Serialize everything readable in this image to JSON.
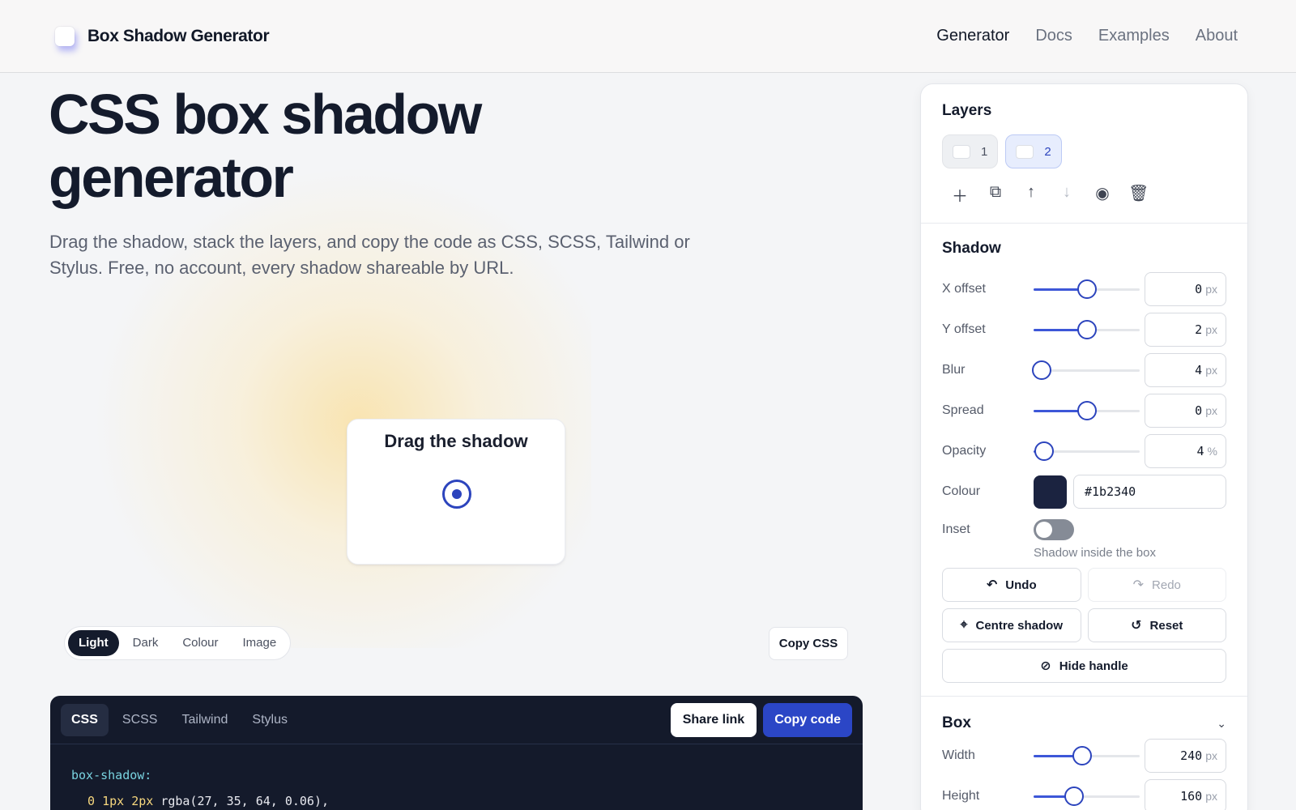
{
  "header": {
    "brand": "Box Shadow Generator",
    "nav": [
      "Generator",
      "Docs",
      "Examples",
      "About"
    ],
    "active_nav": "Generator"
  },
  "hero": {
    "title": "CSS box shadow generator",
    "subtitle": "Drag the shadow, stack the layers, and copy the code as CSS, SCSS, Tailwind or Stylus. Free, no account, every shadow shareable by URL."
  },
  "preview": {
    "label": "Drag the shadow"
  },
  "background_options": {
    "items": [
      "Light",
      "Dark",
      "Colour",
      "Image"
    ],
    "selected": "Light"
  },
  "copy_css_label": "Copy CSS",
  "code": {
    "tabs": [
      "CSS",
      "SCSS",
      "Tailwind",
      "Stylus"
    ],
    "active_tab": "CSS",
    "share_label": "Share link",
    "copy_label": "Copy code",
    "line1": "box-shadow:",
    "line2_parts": [
      "0",
      "1px",
      "2px",
      "rgba(27, 35, 64, 0.06),"
    ]
  },
  "layers": {
    "title": "Layers",
    "items": [
      "1",
      "2"
    ],
    "selected": "2",
    "tools": [
      "add-icon",
      "duplicate-icon",
      "move-up-icon",
      "move-down-icon",
      "visibility-icon",
      "delete-icon"
    ]
  },
  "shadow": {
    "title": "Shadow",
    "controls": [
      {
        "label": "X offset",
        "value": "0",
        "unit": "px",
        "fraction": 0.5
      },
      {
        "label": "Y offset",
        "value": "2",
        "unit": "px",
        "fraction": 0.5
      },
      {
        "label": "Blur",
        "value": "4",
        "unit": "px",
        "fraction": 0.08
      },
      {
        "label": "Spread",
        "value": "0",
        "unit": "px",
        "fraction": 0.5
      },
      {
        "label": "Opacity",
        "value": "4",
        "unit": "%",
        "fraction": 0.1
      }
    ],
    "colour_label": "Colour",
    "colour_hex": "#1b2340",
    "inset_label": "Inset",
    "inset_on": false,
    "inset_hint": "Shadow inside the box",
    "buttons": {
      "undo": "Undo",
      "redo": "Redo",
      "centre": "Centre shadow",
      "reset": "Reset",
      "hide_handle": "Hide handle"
    }
  },
  "box": {
    "title": "Box",
    "controls": [
      {
        "label": "Width",
        "value": "240",
        "unit": "px",
        "fraction": 0.46
      },
      {
        "label": "Height",
        "value": "160",
        "unit": "px",
        "fraction": 0.38
      }
    ]
  },
  "colors": {
    "accent": "#2c44bd",
    "code_bg": "#141a2b",
    "text_dark": "#141b2c"
  }
}
